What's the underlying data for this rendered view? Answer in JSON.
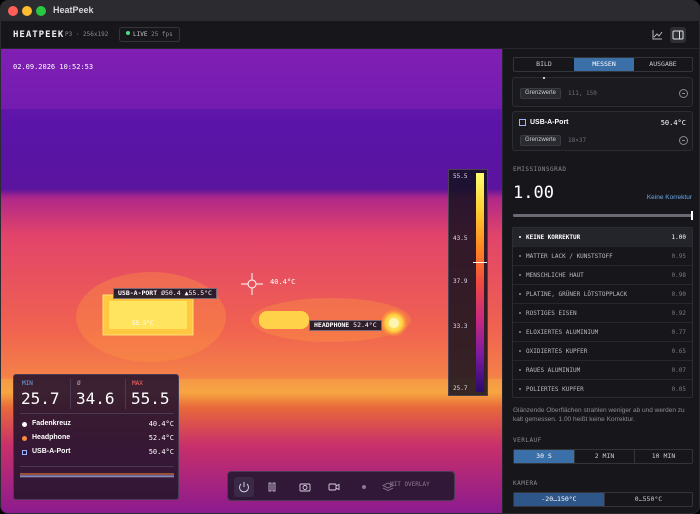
{
  "window": {
    "title": "HeatPeek"
  },
  "toolbar": {
    "brand": "HEATPEEK",
    "device": "P3 · 256x192",
    "live_label": "LIVE",
    "fps": "25 fps",
    "icons": [
      "chart-icon",
      "sidebar-toggle-icon"
    ]
  },
  "view": {
    "timestamp": "02.09.2026   10:52:53",
    "scale": {
      "max": "55.5",
      "t2": "43.5",
      "t3": "37.9",
      "t4": "33.3",
      "min": "25.7"
    },
    "tags": {
      "usb": {
        "name": "USB-A-PORT",
        "avg": "Ø50.4",
        "max": "▲55.5°C"
      },
      "headphone": {
        "name": "HEADPHONE",
        "value": "52.4°C"
      },
      "crosshair": "40.4°C",
      "roi_inner": "55.5°C"
    },
    "stats": {
      "min_label": "MIN",
      "min": "25.7",
      "avg_label": "Ø",
      "avg": "34.6",
      "max_label": "MAX",
      "max": "55.5",
      "rows": [
        {
          "name": "Fadenkreuz",
          "value": "40.4°C"
        },
        {
          "name": "Headphone",
          "value": "52.4°C"
        },
        {
          "name": "USB-A-Port",
          "value": "50.4°C"
        }
      ]
    },
    "controls": {
      "overlay_label": "MIT OVERLAY"
    }
  },
  "panel": {
    "tabs": [
      "BILD",
      "MESSEN",
      "AUSGABE"
    ],
    "active_tab": "MESSEN",
    "card1": {
      "btn": "Grenzwerte",
      "coords": "111, 150"
    },
    "card2": {
      "name": "USB-A-Port",
      "value": "50.4°C",
      "btn": "Grenzwerte",
      "size": "18×37"
    },
    "emission": {
      "section": "EMISSIONSGRAD",
      "value": "1.00",
      "link": "Keine Korrektur",
      "level": 1.0,
      "materials": [
        {
          "name": "KEINE KORREKTUR",
          "value": "1.00"
        },
        {
          "name": "MATTER LACK / KUNSTSTOFF",
          "value": "0.95"
        },
        {
          "name": "MENSCHLICHE HAUT",
          "value": "0.98"
        },
        {
          "name": "PLATINE, GRÜNER LÖTSTOPPLACK",
          "value": "0.90"
        },
        {
          "name": "ROSTIGES EISEN",
          "value": "0.92"
        },
        {
          "name": "ELOXIERTES ALUMINIUM",
          "value": "0.77"
        },
        {
          "name": "OXIDIERTES KUPFER",
          "value": "0.65"
        },
        {
          "name": "RAUES ALUMINIUM",
          "value": "0.07"
        },
        {
          "name": "POLIERTES KUPFER",
          "value": "0.05"
        }
      ],
      "note": "Glänzende Oberflächen strahlen weniger ab und werden zu kalt gemessen. 1.00 heißt keine Korrektur."
    },
    "history": {
      "section": "VERLAUF",
      "options": [
        "30 S",
        "2 MIN",
        "10 MIN"
      ],
      "active": "30 S"
    },
    "camera": {
      "section": "KAMERA",
      "options": [
        "-20…150°C",
        "0…550°C"
      ],
      "active": "-20…150°C"
    }
  },
  "colors": {
    "accent": "#3a6fa8",
    "live": "#4ade80",
    "link": "#6aa8e8"
  }
}
